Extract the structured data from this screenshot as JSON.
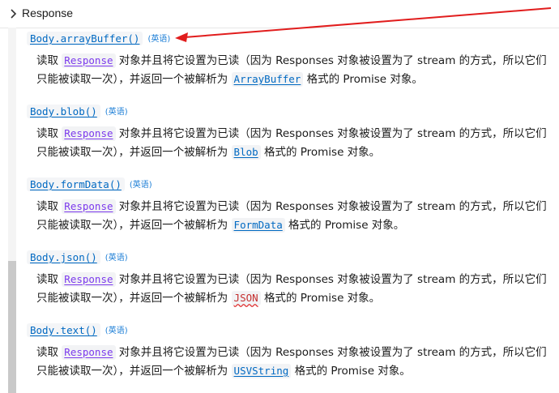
{
  "breadcrumb": {
    "label": "Response"
  },
  "entries": [
    {
      "name": "Body.arrayBuffer()",
      "lang": "(英语)",
      "pre": "读取 ",
      "link1": "Response",
      "mid": " 对象并且将它设置为已读（因为 Responses 对象被设置为了 stream 的方式，所以它们只能被读取一次），并返回一个被解析为 ",
      "link2": "ArrayBuffer",
      "post": " 格式的 Promise 对象。"
    },
    {
      "name": "Body.blob()",
      "lang": "(英语)",
      "pre": "读取 ",
      "link1": "Response",
      "mid": " 对象并且将它设置为已读（因为 Responses 对象被设置为了 stream 的方式，所以它们只能被读取一次），并返回一个被解析为 ",
      "link2": "Blob",
      "post": " 格式的 Promise 对象。"
    },
    {
      "name": "Body.formData()",
      "lang": "(英语)",
      "pre": "读取 ",
      "link1": "Response",
      "mid": " 对象并且将它设置为已读（因为 Responses 对象被设置为了 stream 的方式，所以它们只能被读取一次），并返回一个被解析为 ",
      "link2": "FormData",
      "post": " 格式的 Promise 对象。"
    },
    {
      "name": "Body.json()",
      "lang": "(英语)",
      "pre": "读取 ",
      "link1": "Response",
      "mid": " 对象并且将它设置为已读（因为 Responses 对象被设置为了 stream 的方式，所以它们只能被读取一次），并返回一个被解析为 ",
      "link2": "JSON",
      "post": " 格式的 Promise 对象。"
    },
    {
      "name": "Body.text()",
      "lang": "(英语)",
      "pre": "读取 ",
      "link1": "Response",
      "mid": " 对象并且将它设置为已读（因为 Responses 对象被设置为了 stream 的方式，所以它们只能被读取一次），并返回一个被解析为 ",
      "link2": "USVString",
      "post": " 格式的 Promise 对象。"
    }
  ],
  "colors": {
    "link": "#0069c2",
    "visited": "#7c3aed",
    "annotation_arrow": "#e11d1d"
  },
  "icons": [
    "chevron-right-icon"
  ]
}
